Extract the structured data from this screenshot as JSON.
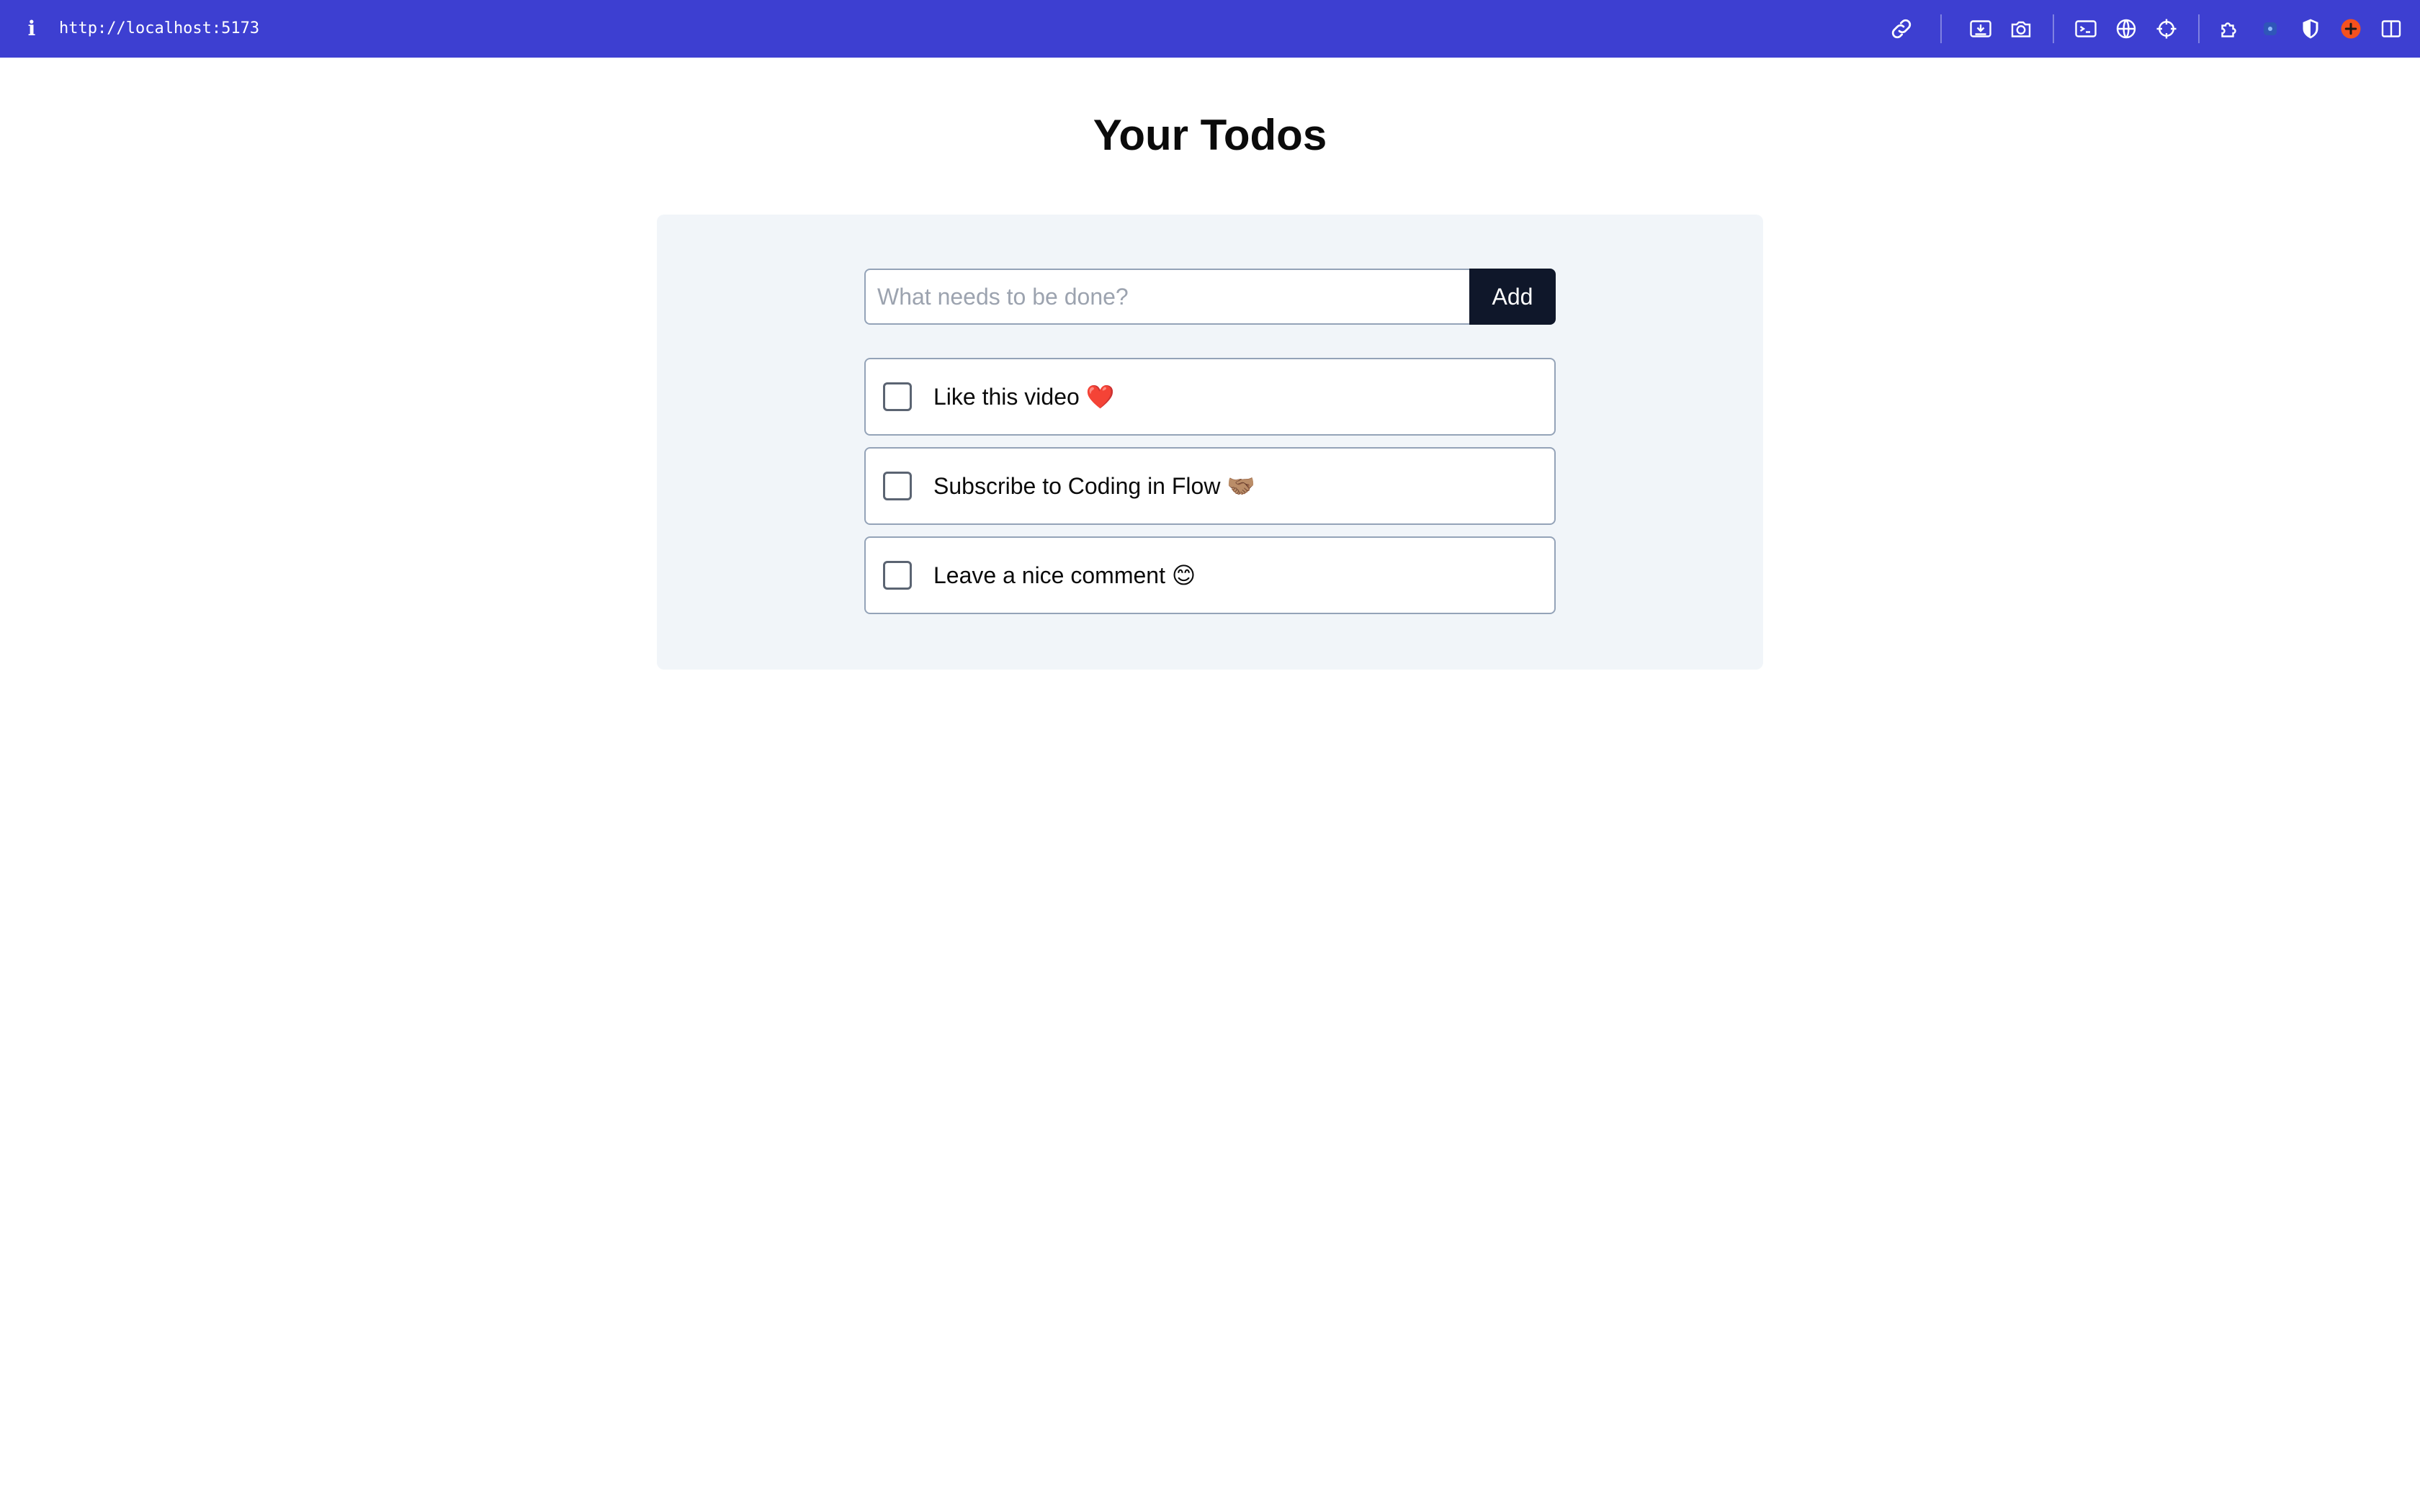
{
  "browser": {
    "url": "http://localhost:5173",
    "accent_color": "#3d3fd1",
    "icons": [
      "info-icon",
      "link-icon",
      "download-icon",
      "camera-icon",
      "terminal-icon",
      "globe-icon",
      "crosshair-icon",
      "puzzle-icon",
      "extension-badge-icon",
      "shield-icon",
      "add-circle-icon",
      "sidebar-icon"
    ]
  },
  "page": {
    "title": "Your Todos"
  },
  "form": {
    "placeholder": "What needs to be done?",
    "add_label": "Add"
  },
  "todos": [
    {
      "title": "Like this video ❤️",
      "completed": false
    },
    {
      "title": "Subscribe to Coding in Flow 🤝🏽",
      "completed": false
    },
    {
      "title": "Leave a nice comment 😊",
      "completed": false
    }
  ]
}
